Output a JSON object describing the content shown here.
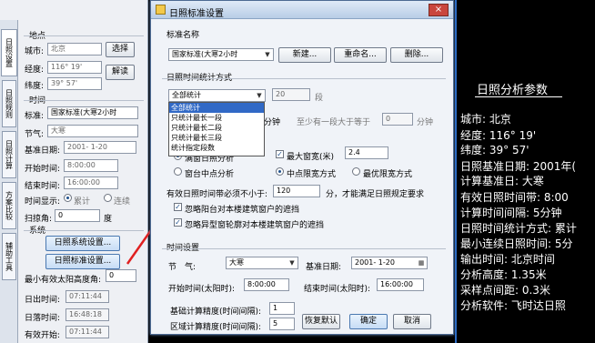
{
  "left_panel": {
    "tabs": [
      "日照设置",
      "日照规则",
      "日照计算",
      "方案比较",
      "辅助工具"
    ],
    "location_header": "地点",
    "city_label": "城市:",
    "city_value": "北京",
    "select_button": "选择",
    "longitude_label": "经度:",
    "longitude_value": "116° 19'",
    "parse_button": "解读",
    "latitude_label": "纬度:",
    "latitude_value": "39° 57'",
    "time_header": "时间",
    "standard_label": "标准:",
    "standard_value": "国家标准(大寒2小时",
    "term_label": "节气:",
    "term_value": "大寒",
    "base_date_label": "基准日期:",
    "base_date_value": "2001- 1-20",
    "start_label": "开始时间:",
    "start_value": "8:00:00",
    "end_label": "结束时间:",
    "end_value": "16:00:00",
    "display_label": "时间显示:",
    "display_opt1": "累计",
    "display_opt2": "连续",
    "scan_label": "扫掠角:",
    "scan_value": "0",
    "scan_unit": "度",
    "system_header": "系统",
    "sys_settings_button": "日照系统设置...",
    "std_settings_button": "日照标准设置...",
    "min_height_label": "最小有效太阳高度角:",
    "min_height_value": "0",
    "sunrise_label": "日出时间:",
    "sunrise_value": "07:11:44",
    "sunset_label": "日落时间:",
    "sunset_value": "16:48:18",
    "valid_start_label": "有效开始:",
    "valid_start_value": "07:11:44"
  },
  "dialog": {
    "title": "日照标准设置",
    "close_label": "×",
    "std_name_header": "标准名称",
    "std_name_value": "国家标准(大寒2小时",
    "new_button": "新建...",
    "rename_button": "重命名...",
    "delete_button": "删除...",
    "stat_header": "日照时间统计方式",
    "stat_selected": "全部统计",
    "stat_options": [
      "全部统计",
      "只统计最长一段",
      "只统计最长二段",
      "只统计最长三段",
      "统计指定段数"
    ],
    "seg_value": "20",
    "seg_unit": "段",
    "minutes_unit": "分钟",
    "min_seg_label": "至少有一段大于等于",
    "min_seg_value": "0",
    "min_seg_unit": "分钟",
    "opt_both": "满窗日照分析",
    "opt_max_width": "最大窗宽(米)",
    "max_width_value": "2.4",
    "opt_center": "窗台中点分析",
    "opt_center_limit": "中点限宽方式",
    "opt_best_limit": "最优限宽方式",
    "valid_band_label": "有效日照时间带必须不小于:",
    "valid_band_value": "120",
    "valid_band_suffix": "分，才能满足日照规定要求",
    "ignore_balcony": "忽略阳台对本楼建筑窗户的遮挡",
    "ignore_irregular": "忽略异型窗轮廓对本楼建筑窗户的遮挡",
    "time_header": "时间设置",
    "term_label": "节　气:",
    "term_value": "大寒",
    "base_date_label": "基准日期:",
    "base_date_value": "2001- 1-20",
    "start_label": "开始时间(太阳时):",
    "start_value": "8:00:00",
    "end_label": "结束时间(太阳时):",
    "end_value": "16:00:00",
    "base_precision_label": "基础计算精度(时间间隔):",
    "base_precision_value": "1",
    "region_precision_label": "区域计算精度(时间间隔):",
    "region_precision_value": "5",
    "reset_button": "恢复默认",
    "ok_button": "确定",
    "cancel_button": "取消"
  },
  "right_panel": {
    "title": "日照分析参数",
    "lines": [
      "城市: 北京",
      "经度: 116° 19'",
      "纬度: 39° 57'",
      "日照基准日期: 2001年(",
      "计算基准日: 大寒",
      "有效日照时间带: 8:00",
      "计算时间间隔: 5分钟",
      "日照时间统计方式: 累计",
      "最小连续日照时间: 5分",
      "输出时间: 北京时间",
      "分析高度: 1.35米",
      "采样点间距: 0.3米",
      "分析软件: 飞时达日照"
    ]
  },
  "colors": {
    "accent": "#3169c6",
    "arrow": "#e02020",
    "title_bar": "#b8cde6"
  }
}
